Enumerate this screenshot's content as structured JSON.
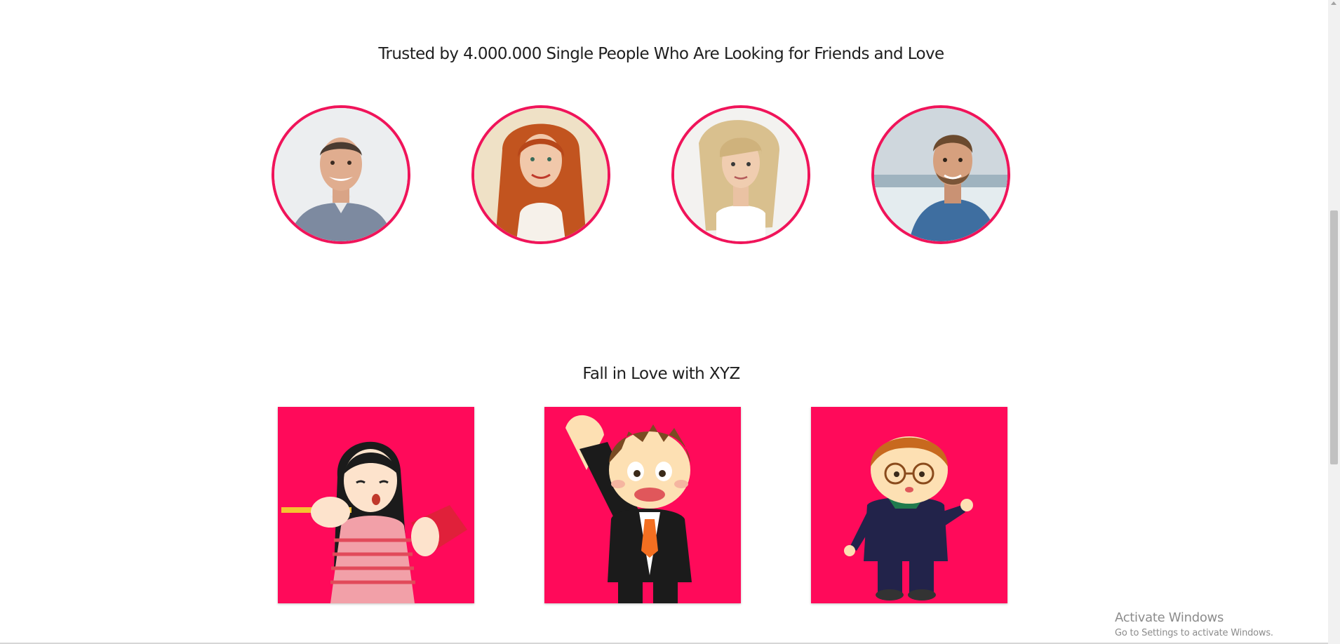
{
  "trusted_section": {
    "title": "Trusted by 4.000.000 Single People Who Are Looking for Friends and Love",
    "members": [
      {
        "icon": "man-smiling-photo"
      },
      {
        "icon": "red-haired-woman-photo"
      },
      {
        "icon": "blonde-woman-photo"
      },
      {
        "icon": "man-beach-photo"
      }
    ],
    "accent_color": "#f0145a"
  },
  "love_section": {
    "title": "Fall in Love with XYZ",
    "cards": [
      {
        "icon": "girl-with-book-illustration"
      },
      {
        "icon": "waving-businessman-illustration"
      },
      {
        "icon": "boy-with-glasses-illustration"
      }
    ],
    "card_color": "#ff0a5a"
  },
  "os_watermark": {
    "title": "Activate Windows",
    "subtitle": "Go to Settings to activate Windows."
  }
}
